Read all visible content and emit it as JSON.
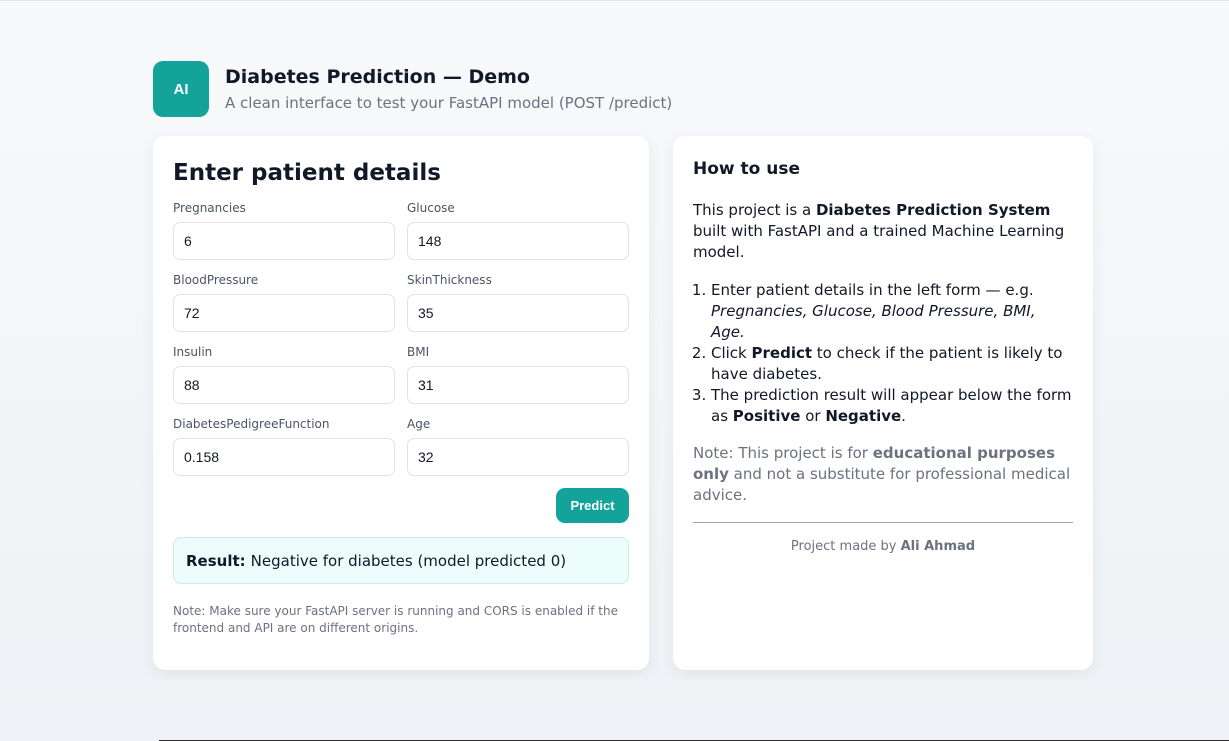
{
  "header": {
    "logo_text": "AI",
    "title": "Diabetes Prediction — Demo",
    "subtitle": "A clean interface to test your FastAPI model (POST /predict)"
  },
  "form": {
    "title": "Enter patient details",
    "fields": [
      {
        "label": "Pregnancies",
        "value": "6"
      },
      {
        "label": "Glucose",
        "value": "148"
      },
      {
        "label": "BloodPressure",
        "value": "72"
      },
      {
        "label": "SkinThickness",
        "value": "35"
      },
      {
        "label": "Insulin",
        "value": "88"
      },
      {
        "label": "BMI",
        "value": "31"
      },
      {
        "label": "DiabetesPedigreeFunction",
        "value": "0.158"
      },
      {
        "label": "Age",
        "value": "32"
      }
    ],
    "predict_label": "Predict",
    "result_label": "Result:",
    "result_text": "Negative for diabetes (model predicted 0)",
    "note": "Note: Make sure your FastAPI server is running and CORS is enabled if the frontend and API are on different origins."
  },
  "howto": {
    "title": "How to use",
    "intro_prefix": "This project is a ",
    "intro_bold": "Diabetes Prediction System",
    "intro_suffix": " built with FastAPI and a trained Machine Learning model.",
    "step1_prefix": "Enter patient details in the left form — e.g. ",
    "step1_italic": "Pregnancies, Glucose, Blood Pressure, BMI, Age.",
    "step2_prefix": "Click ",
    "step2_bold": "Predict",
    "step2_suffix": " to check if the patient is likely to have diabetes.",
    "step3_prefix": "The prediction result will appear below the form as ",
    "step3_bold1": "Positive",
    "step3_mid": " or ",
    "step3_bold2": "Negative",
    "step3_suffix": ".",
    "note_prefix": "Note: This project is for ",
    "note_bold": "educational purposes only",
    "note_suffix": " and not a substitute for professional medical advice.",
    "credit_prefix": "Project made by ",
    "credit_name": "Ali Ahmad"
  },
  "colors": {
    "accent": "#14a39b",
    "result_bg": "#ecfdfb"
  }
}
